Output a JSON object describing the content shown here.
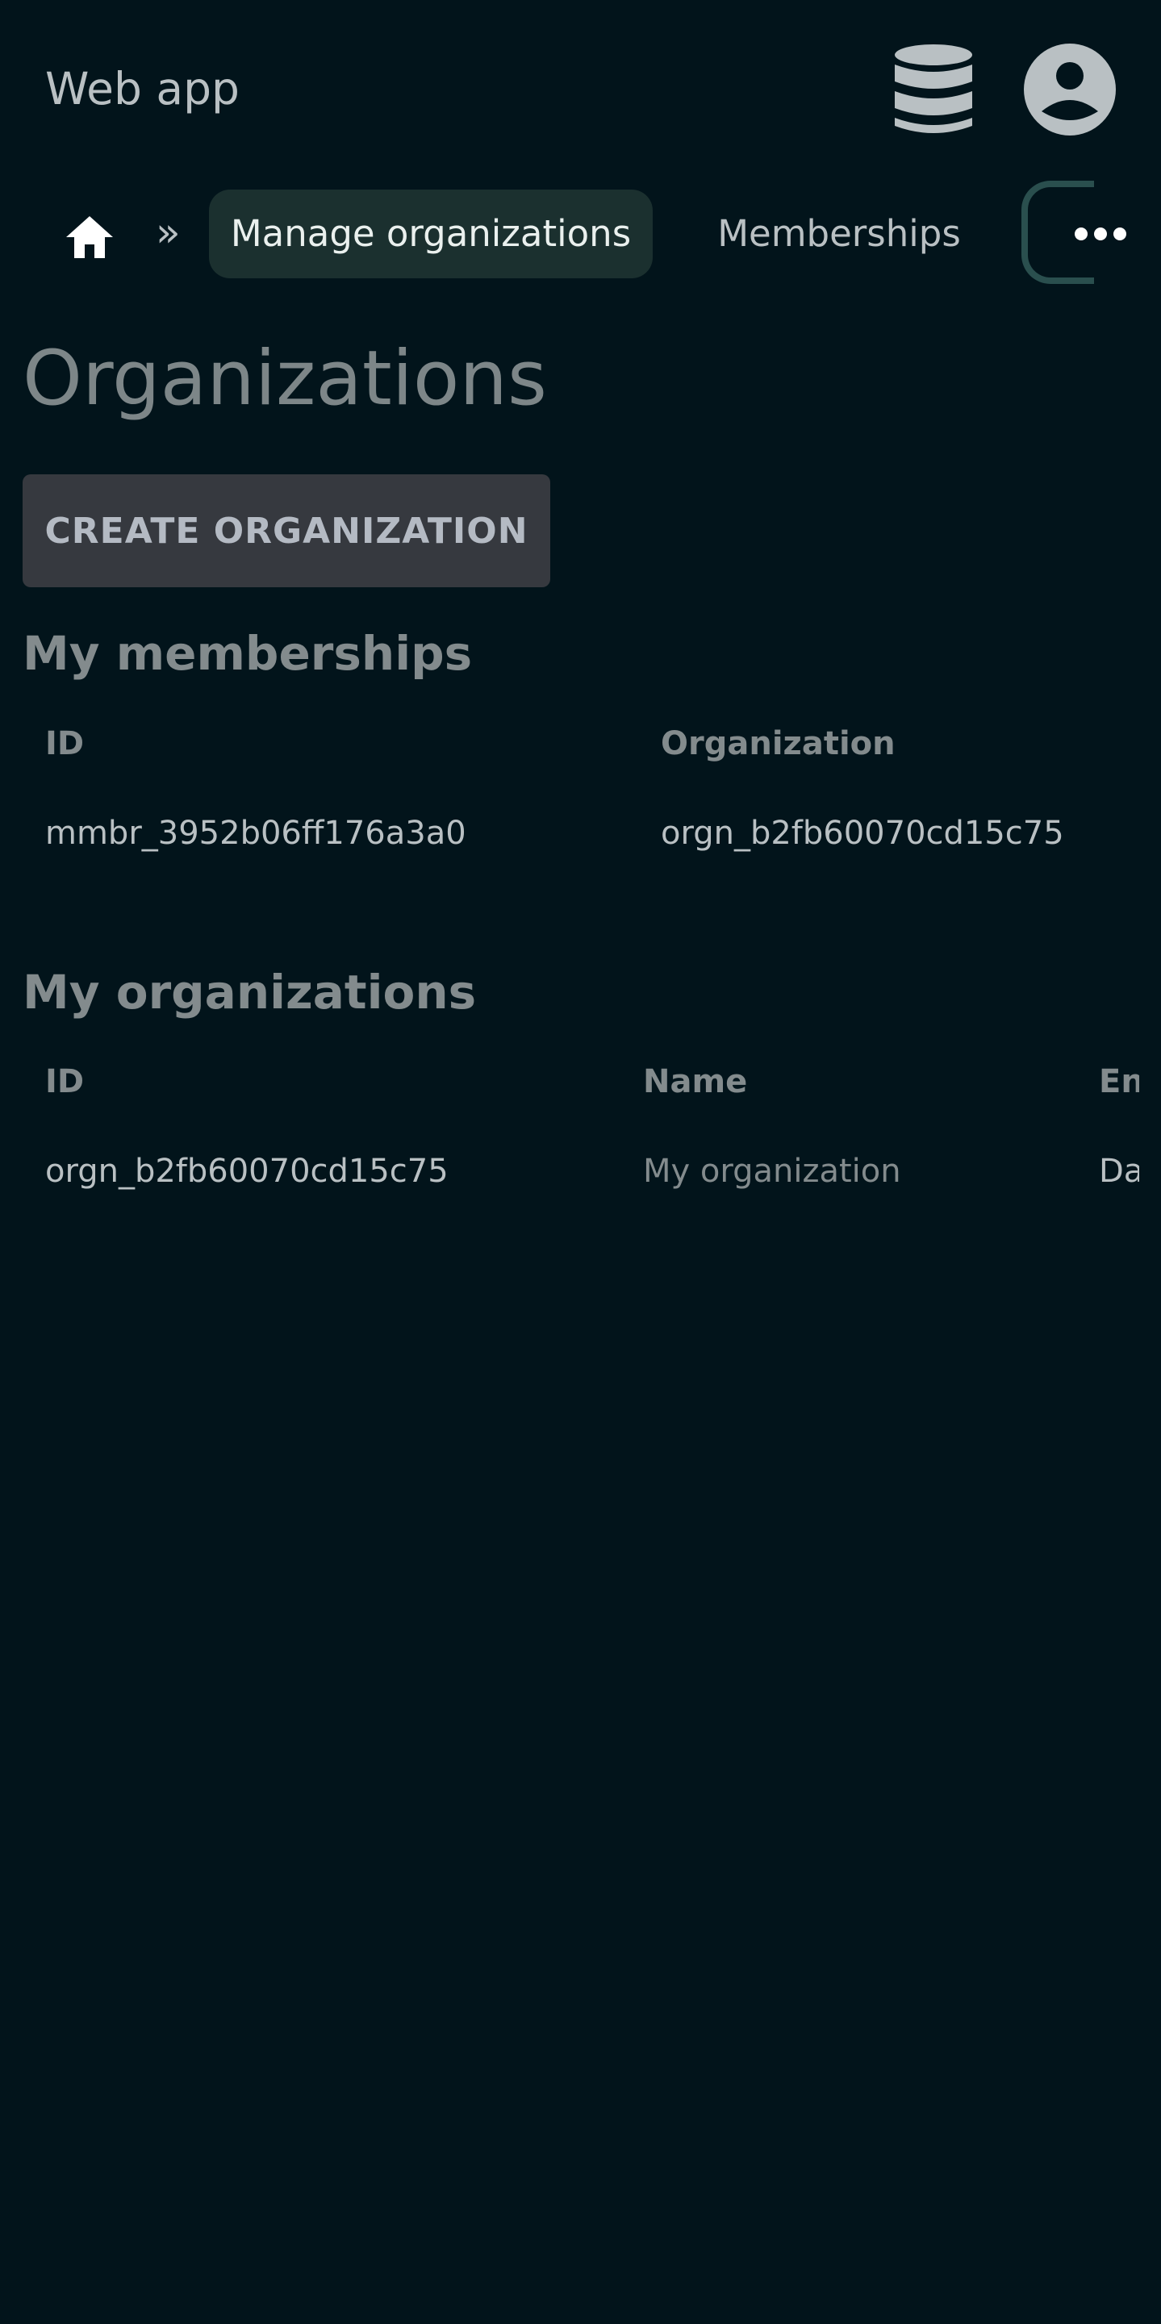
{
  "header": {
    "app_title": "Web app",
    "icons": [
      "database-icon",
      "account-circle-icon"
    ]
  },
  "nav": {
    "home_icon": "home-icon",
    "separator": "»",
    "tabs": [
      {
        "label": "Manage organizations",
        "active": true
      },
      {
        "label": "Memberships",
        "active": false
      },
      {
        "label": "",
        "active": false
      }
    ],
    "more_icon": "more-horizontal-icon"
  },
  "page": {
    "title": "Organizations",
    "create_button": "CREATE ORGANIZATION"
  },
  "memberships": {
    "title": "My memberships",
    "columns": [
      "ID",
      "Organization"
    ],
    "rows": [
      [
        "mmbr_3952b06ff176a3a0",
        "orgn_b2fb60070cd15c75"
      ]
    ]
  },
  "organizations": {
    "title": "My organizations",
    "columns": [
      "ID",
      "Name",
      "En"
    ],
    "rows": [
      [
        "orgn_b2fb60070cd15c75",
        "My organization",
        "Da"
      ]
    ]
  },
  "colors": {
    "background": "#02141b",
    "active_tab": "#1b302f",
    "button": "#36393f",
    "text": "#b9c0c3",
    "muted": "#838b8d"
  }
}
